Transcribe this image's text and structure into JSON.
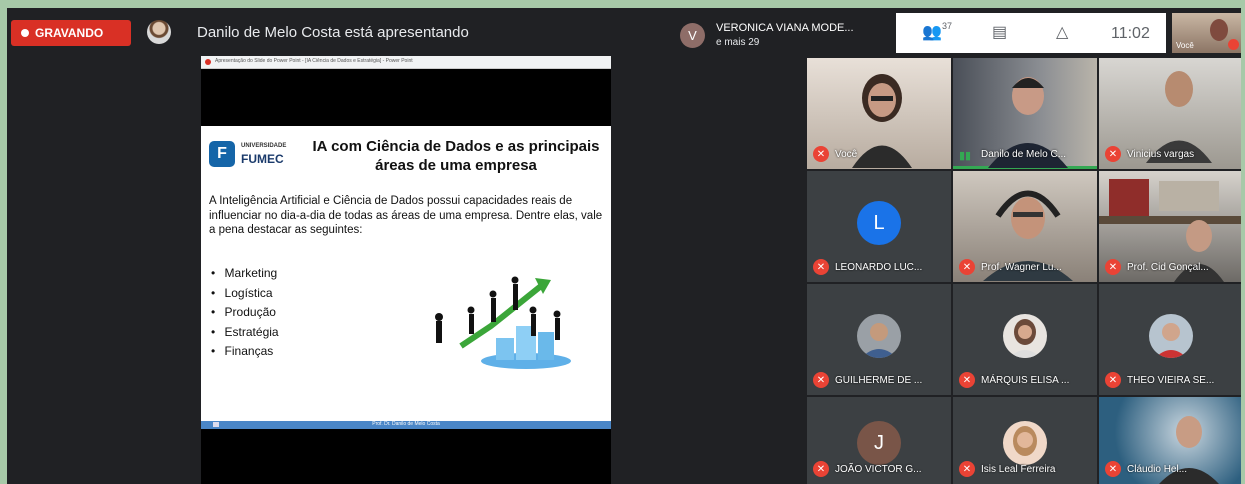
{
  "recording": {
    "label": "GRAVANDO"
  },
  "presenter": {
    "text": "Danilo de Melo Costa está apresentando"
  },
  "speaker": {
    "initial": "V",
    "name": "VERONICA VIANA MODE...",
    "more": "e mais 29"
  },
  "toolbar": {
    "people_count": "37",
    "time": "11:02"
  },
  "self_view": {
    "label": "Você"
  },
  "browser": {
    "tab_text": "Apresentação do Slide do Power Point - [IA Ciência de Dados e Estratégia] - Power Point"
  },
  "slide": {
    "logo_letter": "F",
    "logo_top": "UNIVERSIDADE",
    "logo_name": "FUMEC",
    "title": "IA com Ciência de Dados e as principais áreas de uma empresa",
    "body": "A Inteligência Artificial e Ciência de Dados possui capacidades reais de influenciar no dia-a-dia de todas as áreas de uma empresa. Dentre elas, vale a pena destacar as seguintes:",
    "bullets": [
      "Marketing",
      "Logística",
      "Produção",
      "Estratégia",
      "Finanças"
    ],
    "footer": "Prof. Dr. Danilo de Melo Costa"
  },
  "participants": [
    {
      "name": "Você",
      "muted": true
    },
    {
      "name": "Danilo de Melo C...",
      "muted": false
    },
    {
      "name": "Vinicius vargas",
      "muted": true
    },
    {
      "name": "LEONARDO LUC...",
      "initial": "L",
      "muted": true
    },
    {
      "name": "Prof. Wagner Lu...",
      "muted": true
    },
    {
      "name": "Prof. Cid Gonçal...",
      "muted": true
    },
    {
      "name": "GUILHERME DE ...",
      "muted": true
    },
    {
      "name": "MÁRQUIS ELISA ...",
      "muted": true
    },
    {
      "name": "THEO VIEIRA SE...",
      "muted": true
    },
    {
      "name": "JOÃO VICTOR G...",
      "initial": "J",
      "muted": true
    },
    {
      "name": "Isis Leal Ferreira",
      "muted": true
    },
    {
      "name": "Cláudio Hel...",
      "muted": true
    }
  ],
  "colors": {
    "record_red": "#d93025",
    "meet_bg": "#202124",
    "tile_bg": "#3c4043",
    "mic_red": "#ea4335",
    "avatar_blue": "#1a73e8",
    "avatar_brown": "#795548"
  }
}
